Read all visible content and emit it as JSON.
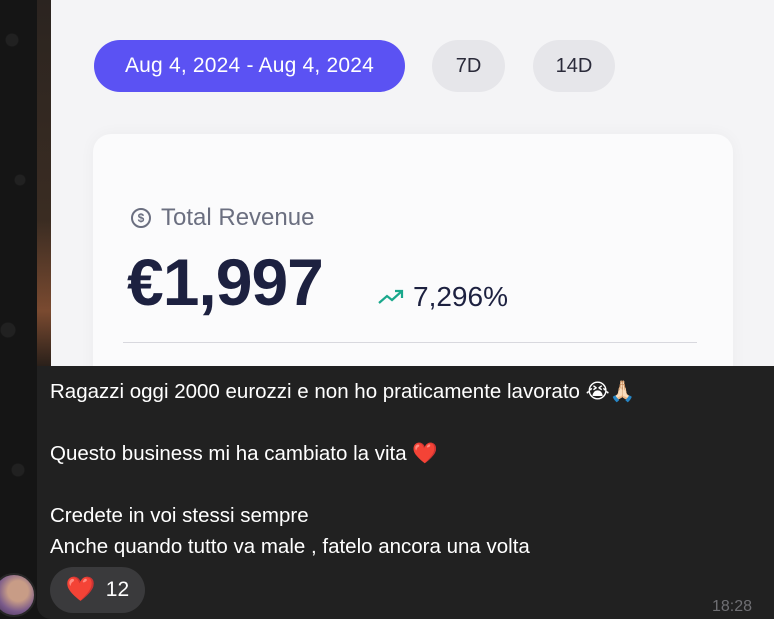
{
  "photo": {
    "date_range": "Aug 4, 2024 - Aug 4, 2024",
    "range_options": [
      "7D",
      "14D"
    ],
    "revenue_label": "Total Revenue",
    "revenue_value": "€1,997",
    "trend_value": "7,296%",
    "icons": {
      "currency": "dollar-circle-icon",
      "trend": "trend-up-icon"
    },
    "colors": {
      "accent": "#5b52f3",
      "trend": "#1aa88c"
    }
  },
  "message": {
    "lines": [
      "Ragazzi oggi 2000 eurozzi e non ho praticamente lavorato 😭🙏🏻",
      "Questo business mi ha cambiato la vita ❤️",
      "Credete in voi stessi sempre",
      "Anche quando tutto va male , fatelo ancora una volta"
    ],
    "reaction": {
      "emoji": "❤️",
      "count": "12"
    },
    "time": "18:28"
  }
}
